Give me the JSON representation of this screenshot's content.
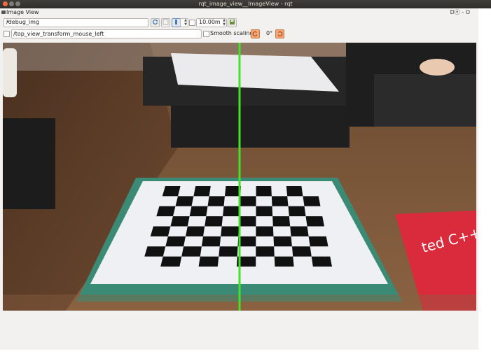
{
  "window": {
    "title": "rqt_image_view__ImageView - rqt"
  },
  "dock": {
    "title": "Image View",
    "controls": "Dⓔ - O"
  },
  "toolbar": {
    "topic_value": "/debug_img",
    "refresh_icon": "refresh-icon",
    "save_icon": "save-icon",
    "zoom_value": "10.00m",
    "mouse_topic": "/top_view_transform_mouse_left",
    "smooth_label": "Smooth scaling",
    "rotation_label": "0°"
  },
  "scene": {
    "board_cols": 10,
    "board_rows": 8,
    "book_text": "ted C++"
  }
}
